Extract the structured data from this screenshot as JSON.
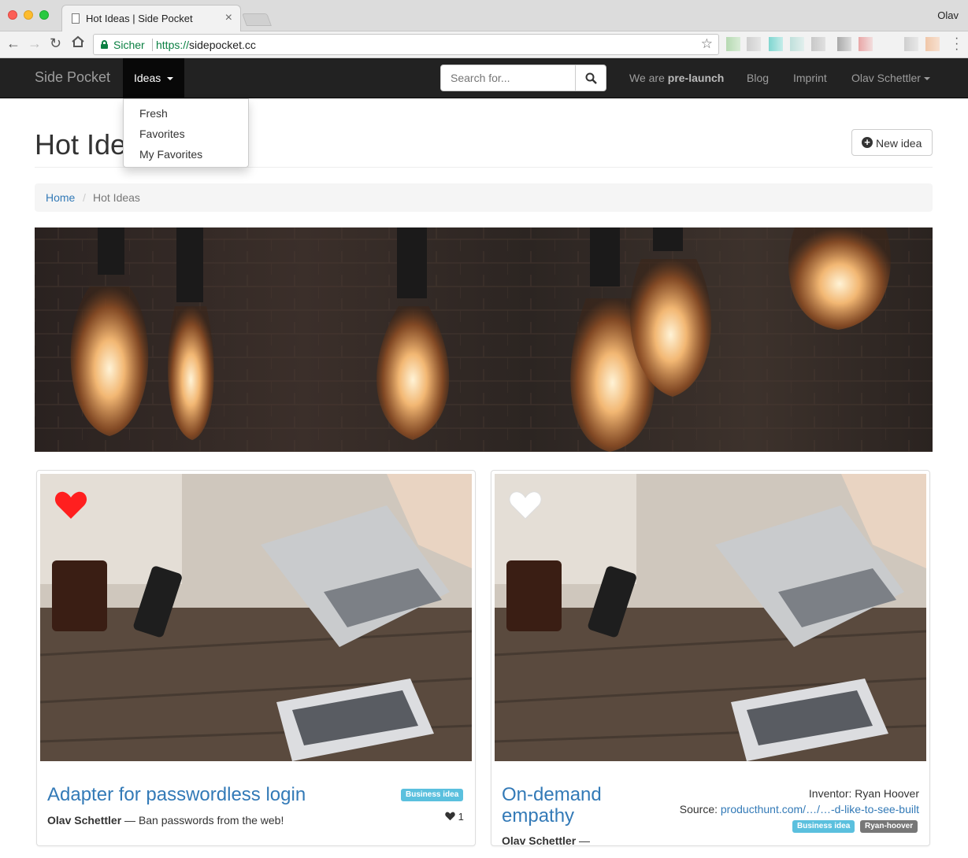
{
  "browser": {
    "tab_title": "Hot Ideas | Side Pocket",
    "tab_close": "×",
    "profile_name": "Olav",
    "secure_label": "Sicher",
    "url_scheme": "https://",
    "url_host": "sidepocket.cc"
  },
  "navbar": {
    "brand": "Side Pocket",
    "ideas_label": "Ideas",
    "search_placeholder": "Search for...",
    "prelaunch_prefix": "We are ",
    "prelaunch_bold": "pre-launch",
    "blog": "Blog",
    "imprint": "Imprint",
    "user": "Olav Schettler"
  },
  "dropdown": {
    "items": [
      "Fresh",
      "Favorites",
      "My Favorites"
    ]
  },
  "page": {
    "title": "Hot Ideas",
    "new_idea": "New idea",
    "breadcrumb": {
      "home": "Home",
      "separator": "/",
      "current": "Hot Ideas"
    }
  },
  "cards": [
    {
      "title": "Adapter for passwordless login",
      "author": "Olav Schettler",
      "dash": " — ",
      "tagline": "Ban passwords from the web!",
      "labels": [
        "Business idea"
      ],
      "favorited": true,
      "favorites_count": "1"
    },
    {
      "title": "On-demand empathy",
      "author": "Olav Schettler",
      "dash": " —",
      "inventor_label": "Inventor:",
      "inventor": "Ryan Hoover",
      "source_label": "Source:",
      "source": "producthunt.com/…/…-d-like-to-see-built",
      "labels": [
        "Business idea",
        "Ryan-hoover"
      ],
      "favorited": false
    }
  ],
  "colors": {
    "navbar_bg": "#222222",
    "link": "#337ab7",
    "label_info": "#5bc0de",
    "label_default": "#777777",
    "heart_active": "#ff1f1f"
  }
}
